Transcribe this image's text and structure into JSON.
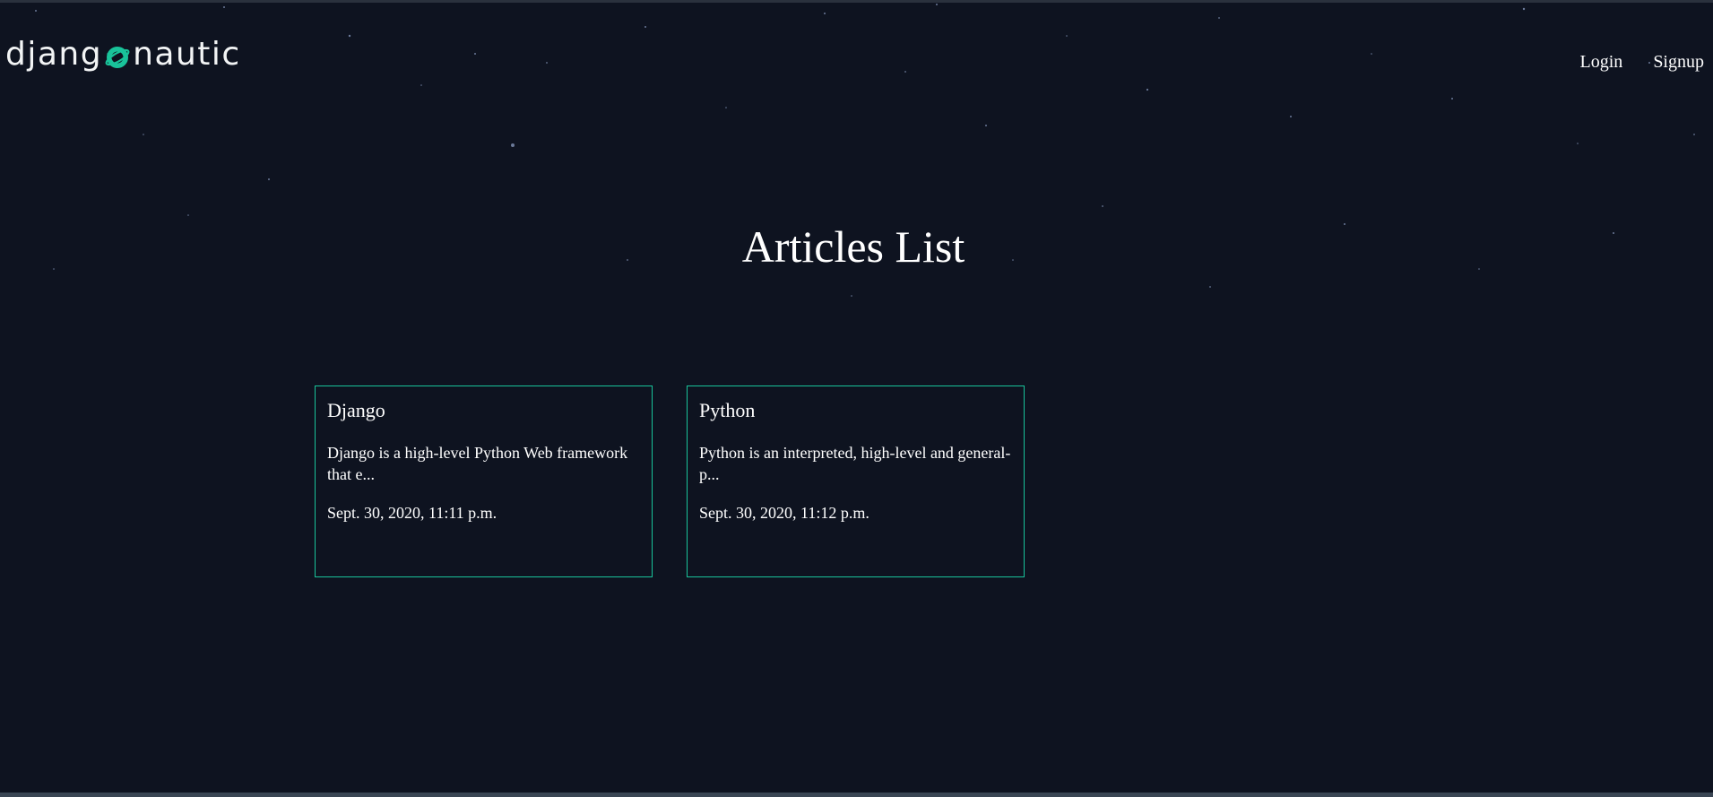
{
  "header": {
    "logo_text_left": "djang",
    "logo_text_right": "nautic",
    "logo_icon": "planet-o-icon",
    "nav": {
      "login_label": "Login",
      "signup_label": "Signup"
    }
  },
  "main": {
    "title": "Articles List",
    "articles": [
      {
        "title": "Django",
        "snippet": "Django is a high-level Python Web framework that e...",
        "date": "Sept. 30, 2020, 11:11 p.m."
      },
      {
        "title": "Python",
        "snippet": "Python is an interpreted, high-level and general-p...",
        "date": "Sept. 30, 2020, 11:12 p.m."
      }
    ]
  },
  "colors": {
    "background": "#0e1320",
    "accent": "#19c39a",
    "text": "#ffffff"
  }
}
